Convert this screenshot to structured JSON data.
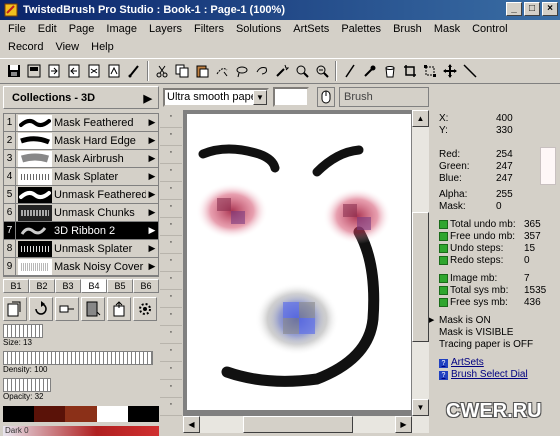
{
  "window": {
    "title": "TwistedBrush Pro Studio : Book-1 : Page-1 (100%)"
  },
  "menu": [
    "File",
    "Edit",
    "Page",
    "Image",
    "Layers",
    "Filters",
    "Solutions",
    "ArtSets",
    "Palettes",
    "Brush",
    "Mask",
    "Control",
    "Record",
    "View",
    "Help"
  ],
  "toolbar_icons": [
    "save-icon",
    "save-as-icon",
    "export-icon",
    "import-icon",
    "page-icon",
    "page-copy-icon",
    "brush-icon",
    "cut-icon",
    "copy-icon",
    "paste-icon",
    "select-icon",
    "lasso-icon",
    "lasso-free-icon",
    "magic-wand-icon",
    "zoom-icon",
    "zoom-fit-icon",
    "pen-icon",
    "eyedropper-icon",
    "bucket-icon",
    "crop-icon",
    "resize-icon",
    "move-icon",
    "line-icon"
  ],
  "collections": {
    "title": "Collections - 3D"
  },
  "brushes": [
    {
      "num": "1",
      "name": "Mask Feathered"
    },
    {
      "num": "2",
      "name": "Mask Hard Edge"
    },
    {
      "num": "3",
      "name": "Mask Airbrush"
    },
    {
      "num": "4",
      "name": "Mask Splater"
    },
    {
      "num": "5",
      "name": "Unmask Feathered"
    },
    {
      "num": "6",
      "name": "Unmask Chunks"
    },
    {
      "num": "7",
      "name": "3D Ribbon 2"
    },
    {
      "num": "8",
      "name": "Unmask Splater"
    },
    {
      "num": "9",
      "name": "Mask Noisy Cover Me"
    }
  ],
  "brush_tabs": [
    "B1",
    "B2",
    "B3",
    "B4",
    "B5",
    "B6"
  ],
  "active_tab": "B4",
  "sliders": {
    "size": "Size: 13",
    "density": "Density: 100",
    "opacity": "Opacity: 32",
    "bottom": "Dark 0"
  },
  "paper": {
    "selected": "Ultra smooth paper",
    "brush_field": "Brush"
  },
  "info": {
    "x_label": "X:",
    "x": "400",
    "y_label": "Y:",
    "y": "330",
    "red_label": "Red:",
    "red": "254",
    "green_label": "Green:",
    "green": "247",
    "blue_label": "Blue:",
    "blue": "247",
    "alpha_label": "Alpha:",
    "alpha": "255",
    "mask_label": "Mask:",
    "mask": "0",
    "total_undo_label": "Total undo mb:",
    "total_undo": "365",
    "free_undo_label": "Free undo mb:",
    "free_undo": "357",
    "undo_steps_label": "Undo steps:",
    "undo_steps": "15",
    "redo_steps_label": "Redo steps:",
    "redo_steps": "0",
    "image_mb_label": "Image mb:",
    "image_mb": "7",
    "total_sys_label": "Total sys mb:",
    "total_sys": "1535",
    "free_sys_label": "Free sys mb:",
    "free_sys": "436",
    "mask_on": "Mask is ON",
    "mask_visible": "Mask is VISIBLE",
    "tracing": "Tracing paper is OFF",
    "link_artsets": "ArtSets",
    "link_brush_select": "Brush Select Dial"
  },
  "watermark": "CWER.RU",
  "colors": {
    "accent": "#0a246a",
    "face_red": "#c04050",
    "face_blue": "#6070e0"
  }
}
